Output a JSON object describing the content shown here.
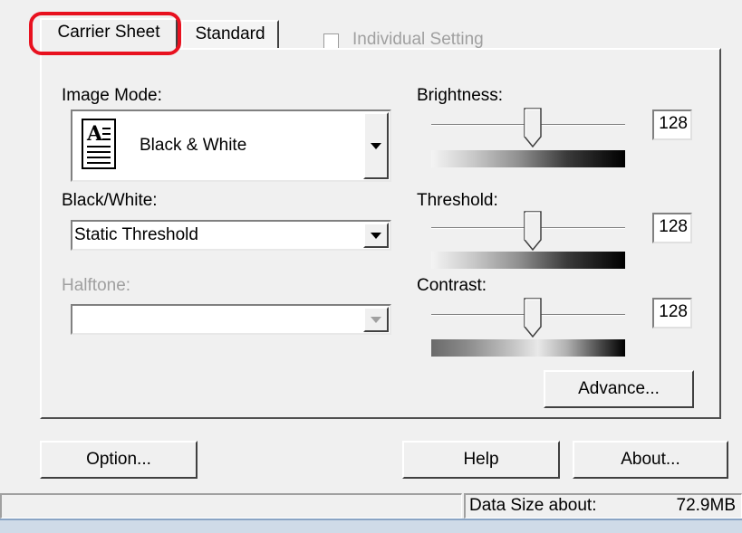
{
  "tabs": {
    "carrier_sheet": "Carrier Sheet",
    "standard": "Standard"
  },
  "individual_setting": {
    "label": "Individual Setting",
    "checked": false,
    "enabled": false
  },
  "image_mode": {
    "label": "Image Mode:",
    "value": "Black & White",
    "icon": "document-text-icon"
  },
  "black_white": {
    "label": "Black/White:",
    "value": "Static Threshold"
  },
  "halftone": {
    "label": "Halftone:",
    "value": "",
    "enabled": false
  },
  "brightness": {
    "label": "Brightness:",
    "value": "128"
  },
  "threshold": {
    "label": "Threshold:",
    "value": "128"
  },
  "contrast": {
    "label": "Contrast:",
    "value": "128"
  },
  "buttons": {
    "advance": "Advance...",
    "option": "Option...",
    "help": "Help",
    "about": "About..."
  },
  "status": {
    "data_size_label": "Data Size about:",
    "data_size_value": "72.9MB"
  },
  "colors": {
    "highlight": "#e8111f",
    "dialog_bg": "#f0f0f0"
  }
}
